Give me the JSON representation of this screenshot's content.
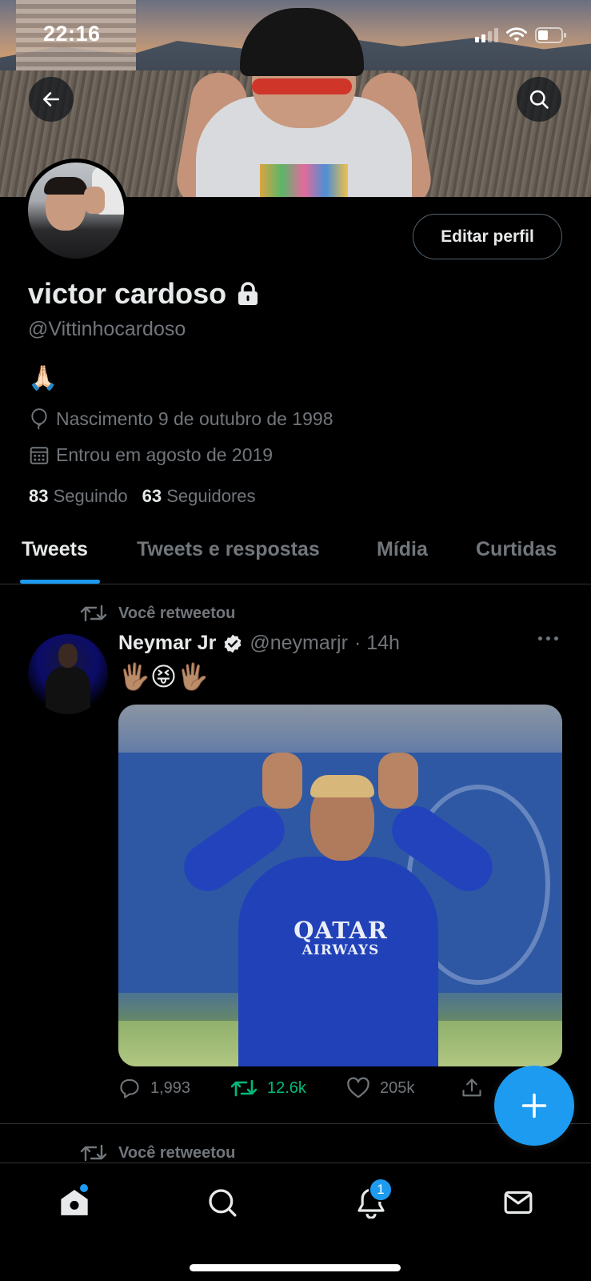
{
  "status_bar": {
    "time": "22:16"
  },
  "profile": {
    "display_name": "victor cardoso",
    "handle": "@Vittinhocardoso",
    "bio": "🙏🏻",
    "birth": "Nascimento 9 de outubro de 1998",
    "joined": "Entrou em agosto de 2019",
    "following_count": "83",
    "following_label": "Seguindo",
    "followers_count": "63",
    "followers_label": "Seguidores",
    "edit_label": "Editar perfil"
  },
  "tabs": [
    {
      "label": "Tweets",
      "active": true
    },
    {
      "label": "Tweets e respostas",
      "active": false
    },
    {
      "label": "Mídia",
      "active": false
    },
    {
      "label": "Curtidas",
      "active": false
    }
  ],
  "timeline": [
    {
      "retweet_label": "Você retweetou",
      "author_name": "Neymar Jr",
      "author_handle": "@neymarjr",
      "time": "· 14h",
      "text": "🖐🏽😝🖐🏽",
      "media_text_1": "QATAR",
      "media_text_2": "AIRWAYS",
      "replies": "1,993",
      "retweets": "12.6k",
      "likes": "205k"
    },
    {
      "retweet_label": "Você retweetou"
    }
  ],
  "bottom_nav": {
    "notification_count": "1"
  },
  "colors": {
    "accent": "#1d9bf0",
    "retweet_green": "#00ba7c",
    "muted": "#71767b",
    "background": "#000000"
  },
  "icons": [
    "back-arrow-icon",
    "search-icon",
    "lock-icon",
    "balloon-icon",
    "calendar-icon",
    "retweet-icon",
    "verified-icon",
    "more-icon",
    "reply-icon",
    "like-icon",
    "share-icon",
    "compose-plus-icon",
    "home-icon",
    "bell-icon",
    "mail-icon"
  ]
}
